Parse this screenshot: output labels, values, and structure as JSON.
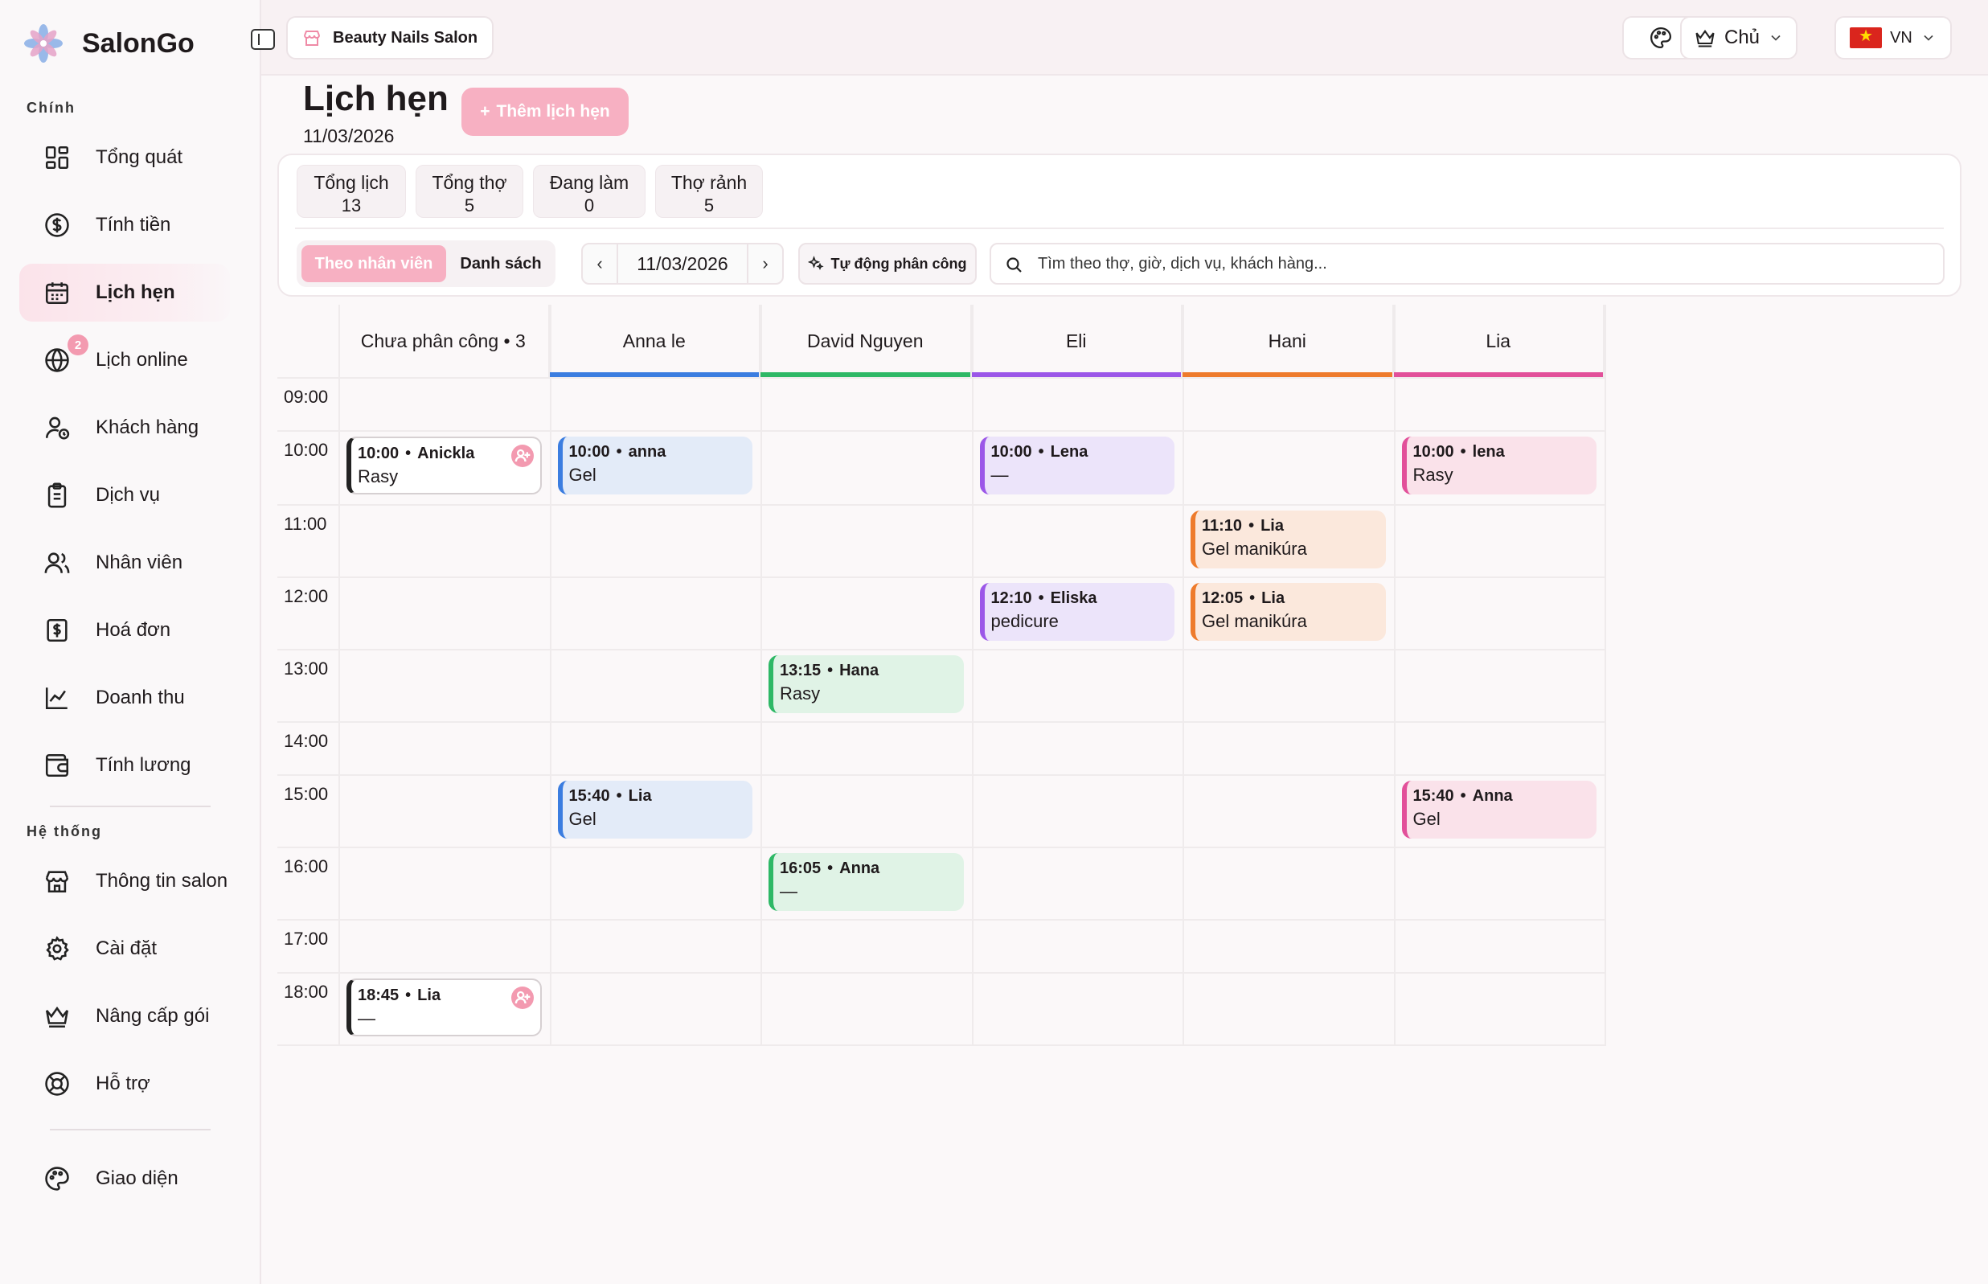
{
  "app": {
    "name": "SalonGo"
  },
  "sidebar": {
    "sections": {
      "main": "Chính",
      "system": "Hệ thống"
    },
    "items": [
      {
        "label": "Tổng quát"
      },
      {
        "label": "Tính tiền"
      },
      {
        "label": "Lịch hẹn"
      },
      {
        "label": "Lịch online",
        "badge": "2"
      },
      {
        "label": "Khách hàng"
      },
      {
        "label": "Dịch vụ"
      },
      {
        "label": "Nhân viên"
      },
      {
        "label": "Hoá đơn"
      },
      {
        "label": "Doanh thu"
      },
      {
        "label": "Tính lương"
      },
      {
        "label": "Thông tin salon"
      },
      {
        "label": "Cài đặt"
      },
      {
        "label": "Nâng cấp gói"
      },
      {
        "label": "Hỗ trợ"
      },
      {
        "label": "Giao diện"
      }
    ]
  },
  "topbar": {
    "salon": "Beauty Nails Salon",
    "role": "Chủ",
    "lang": "VN"
  },
  "page": {
    "title": "Lịch hẹn",
    "date": "11/03/2026",
    "add_label": "Thêm lịch hẹn"
  },
  "stats": [
    {
      "title": "Tổng lịch",
      "value": "13"
    },
    {
      "title": "Tổng thợ",
      "value": "5"
    },
    {
      "title": "Đang làm",
      "value": "0"
    },
    {
      "title": "Thợ rảnh",
      "value": "5"
    }
  ],
  "controls": {
    "view_staff": "Theo nhân viên",
    "view_list": "Danh sách",
    "prev": "‹",
    "next": "›",
    "date": "11/03/2026",
    "auto_assign": "Tự động phân công",
    "search_placeholder": "Tìm theo thợ, giờ, dịch vụ, khách hàng..."
  },
  "calendar": {
    "columns": [
      {
        "name": "Chưa phân công • 3",
        "color": ""
      },
      {
        "name": "Anna le",
        "color": "#3b7de0"
      },
      {
        "name": "David Nguyen",
        "color": "#2eb866"
      },
      {
        "name": "Eli",
        "color": "#9b57e8"
      },
      {
        "name": "Hani",
        "color": "#ee7b2c"
      },
      {
        "name": "Lia",
        "color": "#e2509a"
      }
    ],
    "hours": [
      "09:00",
      "10:00",
      "11:00",
      "12:00",
      "13:00",
      "14:00",
      "15:00",
      "16:00",
      "17:00",
      "18:00"
    ],
    "appointments": [
      {
        "col": 0,
        "hour": 1,
        "time": "10:00",
        "customer": "Anickla",
        "service": "Rasy"
      },
      {
        "col": 0,
        "hour": 9,
        "time": "18:45",
        "customer": "Lia",
        "service": "—"
      },
      {
        "col": 1,
        "hour": 1,
        "time": "10:00",
        "customer": "anna",
        "service": "Gel"
      },
      {
        "col": 1,
        "hour": 6,
        "time": "15:40",
        "customer": "Lia",
        "service": "Gel"
      },
      {
        "col": 2,
        "hour": 4,
        "time": "13:15",
        "customer": "Hana",
        "service": "Rasy"
      },
      {
        "col": 2,
        "hour": 7,
        "time": "16:05",
        "customer": "Anna",
        "service": "—"
      },
      {
        "col": 3,
        "hour": 1,
        "time": "10:00",
        "customer": "Lena",
        "service": "—"
      },
      {
        "col": 3,
        "hour": 3,
        "time": "12:10",
        "customer": "Eliska",
        "service": "pedicure"
      },
      {
        "col": 4,
        "hour": 2,
        "time": "11:10",
        "customer": "Lia",
        "service": "Gel manikúra"
      },
      {
        "col": 4,
        "hour": 3,
        "time": "12:05",
        "customer": "Lia",
        "service": "Gel manikúra"
      },
      {
        "col": 5,
        "hour": 1,
        "time": "10:00",
        "customer": "lena",
        "service": "Rasy"
      },
      {
        "col": 5,
        "hour": 6,
        "time": "15:40",
        "customer": "Anna",
        "service": "Gel"
      }
    ]
  }
}
